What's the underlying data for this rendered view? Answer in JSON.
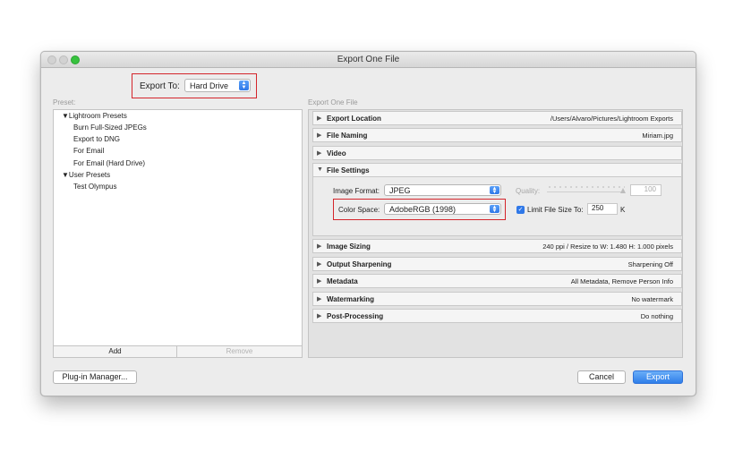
{
  "window": {
    "title": "Export One File"
  },
  "export_to": {
    "label": "Export To:",
    "value": "Hard Drive"
  },
  "preset_panel": {
    "label": "Preset:",
    "groups": [
      {
        "name": "Lightroom Presets",
        "items": [
          "Burn Full-Sized JPEGs",
          "Export to DNG",
          "For Email",
          "For Email (Hard Drive)"
        ]
      },
      {
        "name": "User Presets",
        "items": [
          "Test Olympus"
        ]
      }
    ],
    "add_label": "Add",
    "remove_label": "Remove"
  },
  "export_panel": {
    "label": "Export One File",
    "sections": [
      {
        "name": "Export Location",
        "summary": "/Users/Alvaro/Pictures/Lightroom Exports",
        "expanded": false
      },
      {
        "name": "File Naming",
        "summary": "Miriam.jpg",
        "expanded": false
      },
      {
        "name": "Video",
        "summary": "",
        "expanded": false
      },
      {
        "name": "File Settings",
        "summary": "",
        "expanded": true
      },
      {
        "name": "Image Sizing",
        "summary": "240 ppi / Resize to W: 1.480 H: 1.000 pixels",
        "expanded": false
      },
      {
        "name": "Output Sharpening",
        "summary": "Sharpening Off",
        "expanded": false
      },
      {
        "name": "Metadata",
        "summary": "All Metadata, Remove Person Info",
        "expanded": false
      },
      {
        "name": "Watermarking",
        "summary": "No watermark",
        "expanded": false
      },
      {
        "name": "Post-Processing",
        "summary": "Do nothing",
        "expanded": false
      }
    ],
    "file_settings": {
      "image_format_label": "Image Format:",
      "image_format_value": "JPEG",
      "quality_label": "Quality:",
      "quality_value": "100",
      "color_space_label": "Color Space:",
      "color_space_value": "AdobeRGB (1998)",
      "limit_label": "Limit File Size To:",
      "limit_checked": true,
      "limit_value": "250",
      "limit_unit": "K"
    }
  },
  "footer": {
    "plugin_manager_label": "Plug-in Manager...",
    "cancel_label": "Cancel",
    "export_label": "Export"
  },
  "colors": {
    "accent": "#2f78e8",
    "highlight_box": "#d4252b",
    "traffic_green": "#37c23e"
  }
}
